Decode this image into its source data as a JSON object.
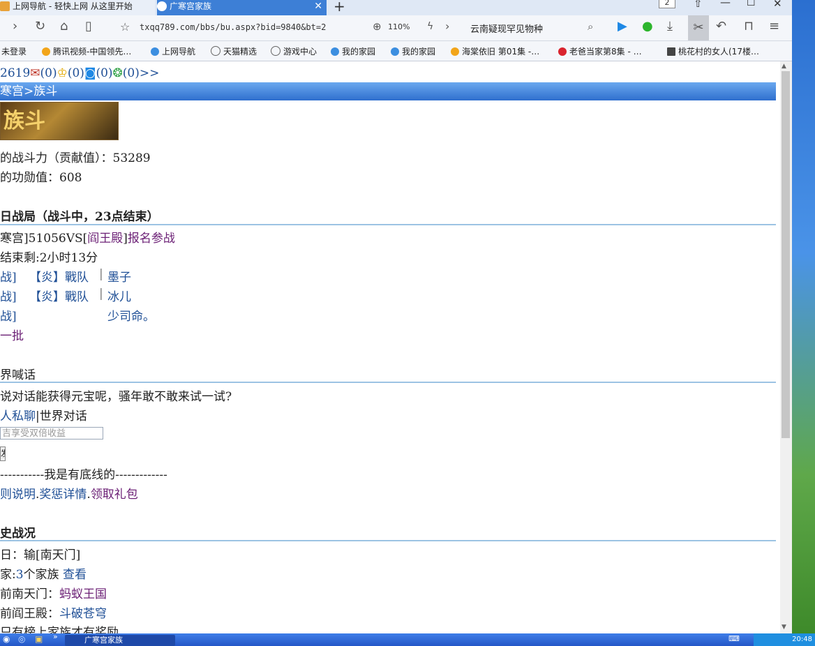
{
  "browser": {
    "tabs": [
      {
        "label": "上网导航 - 轻快上网 从这里开始",
        "active": false
      },
      {
        "label": "广寒宫家族",
        "active": true
      }
    ],
    "window_count": "2",
    "url": "txqq789.com/bbs/bu.aspx?bid=9840&bt=2",
    "zoom": "110%",
    "search_text": "云南疑现罕见物种",
    "accent": "#3d7fd6"
  },
  "bookmarks": [
    {
      "label": "未登录",
      "icon": "user-icon"
    },
    {
      "label": "腾讯视频-中国领先…",
      "icon": "video-play-icon"
    },
    {
      "label": "上网导航",
      "icon": "ie-icon"
    },
    {
      "label": "天猫精选",
      "icon": "globe-icon"
    },
    {
      "label": "游戏中心",
      "icon": "globe-icon"
    },
    {
      "label": "我的家园",
      "icon": "ie-icon"
    },
    {
      "label": "我的家园",
      "icon": "ie-icon"
    },
    {
      "label": "海棠依旧 第01集 -…",
      "icon": "video-play-icon"
    },
    {
      "label": "老爸当家第8集 - …",
      "icon": "youku-icon"
    },
    {
      "label": "桃花村的女人(17楼…",
      "icon": "book-icon"
    }
  ],
  "page": {
    "status_line": {
      "id": "2619",
      "count1": "(0)",
      "count2": "(0)",
      "count3": "(0)",
      "count4": "(0)",
      "more": ">>"
    },
    "breadcrumb": "寒宫>族斗",
    "logo_text": "族斗",
    "power_line": "的战斗力（贡献值）：53289",
    "merit_line": "的功勋值：608",
    "today_header": "日战局（战斗中，23点结束）",
    "vs_prefix": "寒宫]51056VS[",
    "vs_enemy": "阎王殿",
    "vs_bracket": "]",
    "vs_signup": "报名参战",
    "remaining": "结束剩:2小时13分",
    "fighters": [
      {
        "tag": "战]",
        "team": "【炎】戰队",
        "name": "墨子"
      },
      {
        "tag": "战]",
        "team": "【炎】戰队",
        "name": "冰儿"
      },
      {
        "tag": "战]",
        "team": "",
        "name": "少司命。"
      }
    ],
    "next_batch": "一批",
    "shout_header": "界喊话",
    "shout_question": "说对话能获得元宝呢，骚年敢不敢来试一试?",
    "private_chat": "人私聊",
    "world_chat": "世界对话",
    "input_placeholder": "吉享受双倍收益",
    "send_label": "发",
    "divider_text": "-----------我是有底线的-------------",
    "rules": "则说明",
    "rewards": "奖惩详情",
    "gift": "领取礼包",
    "dot": ".",
    "history_header": "史战况",
    "yesterday": "日：输[南天门]",
    "families_prefix": "家:",
    "families_count": "3",
    "families_suffix": "个家族",
    "view": "查看",
    "nantianmen_label": "前南天门：",
    "nantianmen_value": "蚂蚁王国",
    "yanwang_label": "前阎王殿：",
    "yanwang_value": "斗破苍穹",
    "reward_note": "只有榜上家族才有奖励"
  },
  "taskbar": {
    "task_label": "广寒宫家族",
    "clock": "20:48"
  }
}
